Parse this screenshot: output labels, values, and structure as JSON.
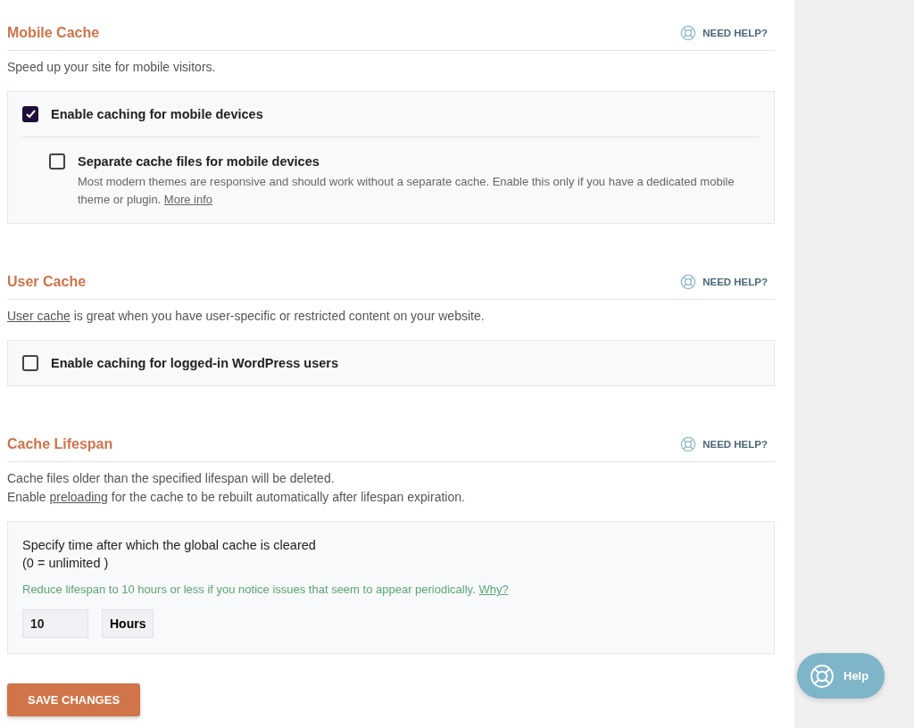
{
  "sections": [
    {
      "title": "Mobile Cache",
      "help": "NEED HELP?",
      "description": [
        [
          {
            "kind": "text",
            "text": "Speed up your site for mobile visitors."
          }
        ]
      ],
      "panel": {
        "kind": "options",
        "options": [
          {
            "label": "Enable caching for mobile devices",
            "checked": true,
            "children": [
              {
                "label": "Separate cache files for mobile devices",
                "checked": false,
                "note": [
                  {
                    "kind": "text",
                    "text": "Most modern themes are responsive and should work without a separate cache. Enable this only if you have a dedicated mobile theme or plugin. "
                  },
                  {
                    "kind": "link",
                    "text": "More info"
                  }
                ]
              }
            ]
          }
        ]
      }
    },
    {
      "title": "User Cache",
      "help": "NEED HELP?",
      "description": [
        [
          {
            "kind": "link",
            "text": "User cache"
          },
          {
            "kind": "text",
            "text": " is great when you have user-specific or restricted content on your website."
          }
        ]
      ],
      "panel": {
        "kind": "options",
        "options": [
          {
            "label": "Enable caching for logged-in WordPress users",
            "checked": false
          }
        ]
      }
    },
    {
      "title": "Cache Lifespan",
      "help": "NEED HELP?",
      "description": [
        [
          {
            "kind": "text",
            "text": "Cache files older than the specified lifespan will be deleted."
          }
        ],
        [
          {
            "kind": "text",
            "text": "Enable "
          },
          {
            "kind": "link",
            "text": "preloading"
          },
          {
            "kind": "text",
            "text": " for the cache to be rebuilt automatically after lifespan expiration."
          }
        ]
      ],
      "panel": {
        "kind": "lifespan",
        "label_lines": [
          "Specify time after which the global cache is cleared",
          "(0 = unlimited )"
        ],
        "hint": [
          {
            "kind": "text",
            "text": "Reduce lifespan to 10 hours or less if you notice issues that seem to appear periodically. "
          },
          {
            "kind": "link",
            "text": "Why?"
          }
        ],
        "value": "10",
        "unit": "Hours"
      }
    }
  ],
  "save_button": "SAVE CHANGES",
  "help_button": "Help"
}
